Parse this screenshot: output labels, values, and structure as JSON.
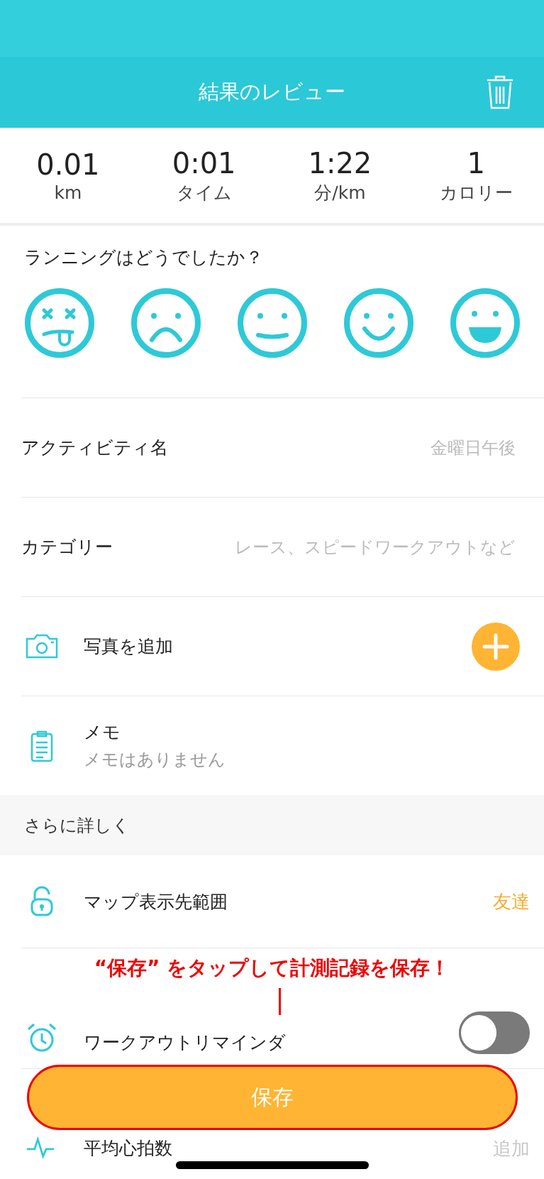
{
  "header": {
    "title": "結果のレビュー"
  },
  "stats": [
    {
      "value": "0.01",
      "label": "km"
    },
    {
      "value": "0:01",
      "label": "タイム"
    },
    {
      "value": "1:22",
      "label": "分/km"
    },
    {
      "value": "1",
      "label": "カロリー"
    }
  ],
  "rating": {
    "question": "ランニングはどうでしたか？",
    "moods": [
      {
        "kind": "dizzy"
      },
      {
        "kind": "sad"
      },
      {
        "kind": "neutral"
      },
      {
        "kind": "smile"
      },
      {
        "kind": "grin"
      }
    ]
  },
  "fields": [
    {
      "kind": "input",
      "label": "アクティビティ名",
      "placeholder": "金曜日午後"
    },
    {
      "kind": "input",
      "label": "カテゴリー",
      "placeholder": "レース、スピードワークアウトなど"
    },
    {
      "kind": "photo",
      "label": "写真を追加"
    },
    {
      "kind": "memo",
      "label": "メモ",
      "subtitle": "メモはありません"
    }
  ],
  "details": {
    "title": "さらに詳しく",
    "rows": [
      {
        "kind": "privacy",
        "label": "マップ表示先範囲",
        "value": "友達"
      },
      {
        "kind": "reminder",
        "label": "ワークアウトリマインダ",
        "on": false
      },
      {
        "kind": "heart_rate",
        "label": "平均心拍数",
        "value": "追加"
      }
    ]
  },
  "annotation": "“保存” をタップして計測記録を保存！",
  "save_button": "保存"
}
